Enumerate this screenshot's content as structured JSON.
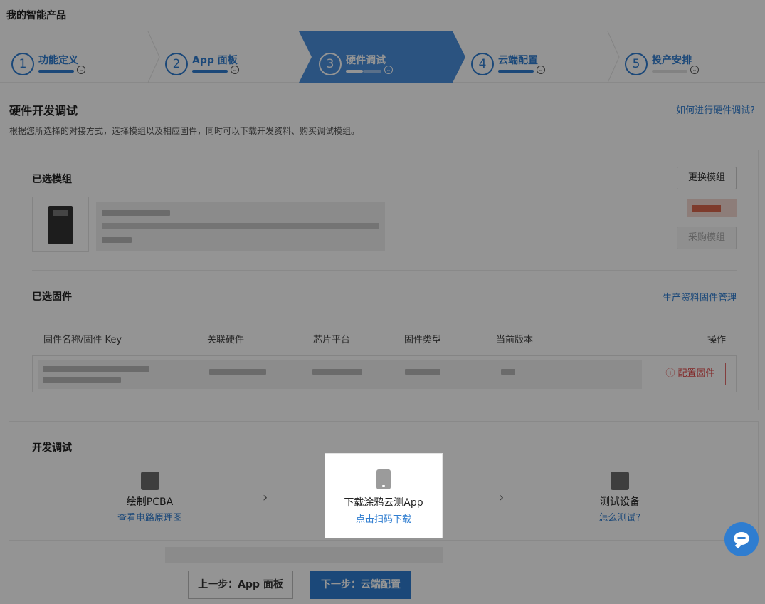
{
  "header": {
    "title": "我的智能产品"
  },
  "steps": [
    {
      "num": "1",
      "label": "功能定义"
    },
    {
      "num": "2",
      "label": "App 面板"
    },
    {
      "num": "3",
      "label": "硬件调试"
    },
    {
      "num": "4",
      "label": "云端配置"
    },
    {
      "num": "5",
      "label": "投产安排"
    }
  ],
  "section": {
    "title": "硬件开发调试",
    "help_link": "如何进行硬件调试?",
    "desc": "根据您所选择的对接方式，选择模组以及相应固件，同时可以下载开发资料、购买调试模组。"
  },
  "module": {
    "heading": "已选模组",
    "change_button": "更换模组",
    "buy_button": "采购模组"
  },
  "firmware": {
    "heading": "已选固件",
    "manage_link": "生产资料固件管理",
    "columns": [
      "固件名称/固件 Key",
      "关联硬件",
      "芯片平台",
      "固件类型",
      "当前版本",
      "操作"
    ],
    "config_button": "ⓘ 配置固件"
  },
  "dev": {
    "heading": "开发调试",
    "tools": [
      {
        "title": "绘制PCBA",
        "link": "查看电路原理图"
      },
      {
        "title": "下载涂鸦云测App",
        "link": "点击扫码下载"
      },
      {
        "title": "测试设备",
        "link": "怎么测试?"
      }
    ]
  },
  "footer": {
    "prev_button": "上一步：App 面板",
    "next_button": "下一步：云端配置"
  },
  "colors": {
    "accent": "#2f7dd0",
    "danger": "#e04848"
  }
}
